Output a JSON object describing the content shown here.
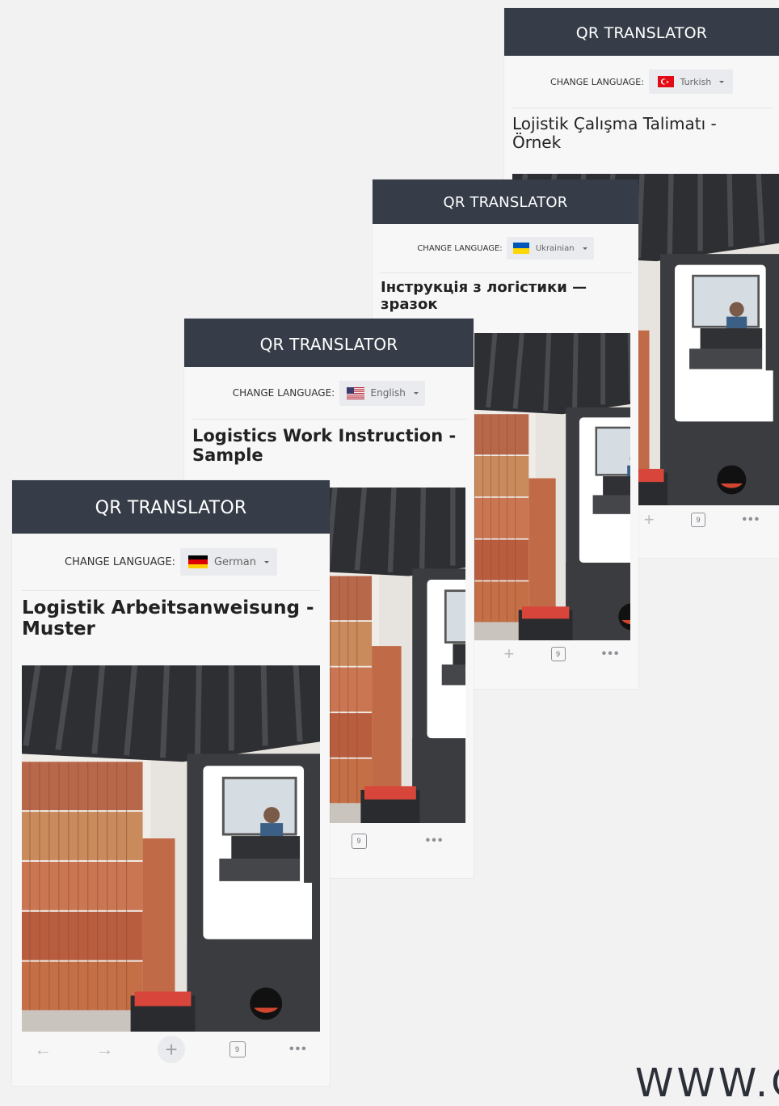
{
  "screens": [
    {
      "header": "QR TRANSLATOR",
      "change_language_label": "CHANGE LANGUAGE:",
      "language": "Turkish",
      "flag": "turkey-flag",
      "title_line1": "Lojistik Çalışma Talimatı -",
      "title_line2": "Örnek",
      "tabs_count": "9"
    },
    {
      "header": "QR TRANSLATOR",
      "change_language_label": "CHANGE LANGUAGE:",
      "language": "Ukrainian",
      "flag": "ukraine-flag",
      "title_line1": "Інструкція з логістики —",
      "title_line2": "зразок",
      "tabs_count": "9"
    },
    {
      "header": "QR TRANSLATOR",
      "change_language_label": "CHANGE LANGUAGE:",
      "language": "English",
      "flag": "usa-flag",
      "title_line1": "Logistics Work Instruction -",
      "title_line2": "Sample",
      "tabs_count": "9"
    },
    {
      "header": "QR TRANSLATOR",
      "change_language_label": "CHANGE LANGUAGE:",
      "language": "German",
      "flag": "germany-flag",
      "title_line1": "Logistik Arbeitsanweisung -",
      "title_line2": "Muster",
      "tabs_count": "9"
    }
  ],
  "watermark": "WWW.C",
  "colors": {
    "header_bg": "#363d48",
    "page_bg": "#f2f2f2",
    "select_bg": "#e9ebee"
  }
}
